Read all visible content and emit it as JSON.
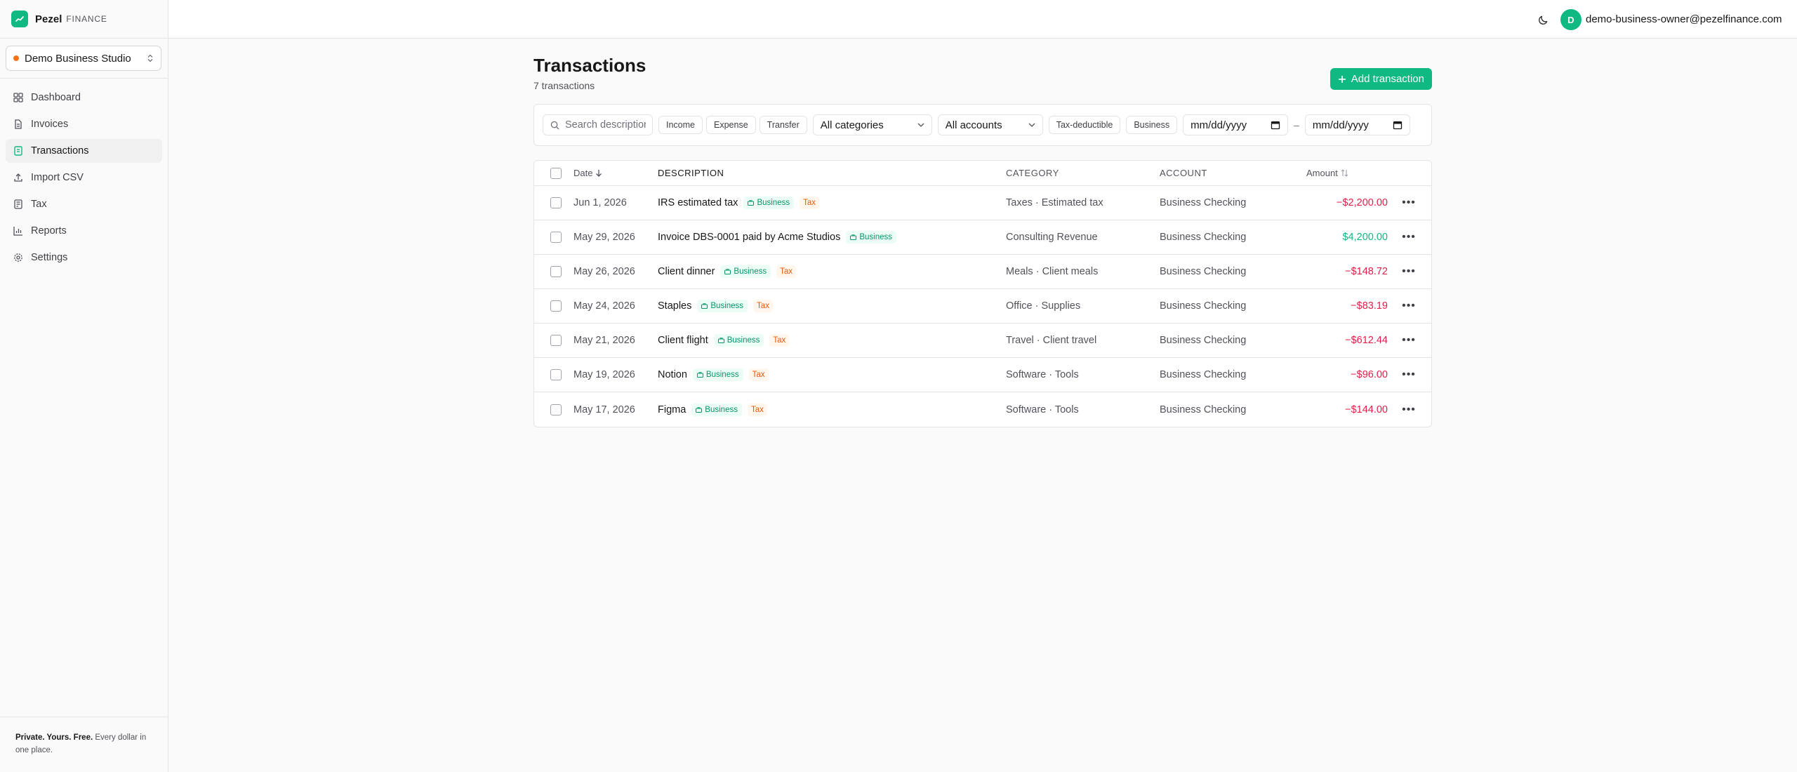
{
  "brand": {
    "name": "Pezel",
    "suffix": "FINANCE"
  },
  "workspace": {
    "name": "Demo Business Studio"
  },
  "nav": [
    {
      "label": "Dashboard",
      "icon": "dashboard-icon",
      "active": false
    },
    {
      "label": "Invoices",
      "icon": "invoice-icon",
      "active": false
    },
    {
      "label": "Transactions",
      "icon": "transactions-icon",
      "active": true
    },
    {
      "label": "Import CSV",
      "icon": "upload-icon",
      "active": false
    },
    {
      "label": "Tax",
      "icon": "tax-icon",
      "active": false
    },
    {
      "label": "Reports",
      "icon": "chart-icon",
      "active": false
    },
    {
      "label": "Settings",
      "icon": "gear-icon",
      "active": false
    }
  ],
  "footer": {
    "bold": "Private. Yours. Free.",
    "text": " Every dollar in one place."
  },
  "user": {
    "initial": "D",
    "email": "demo-business-owner@pezelfinance.com"
  },
  "page": {
    "title": "Transactions",
    "subtitle": "7 transactions",
    "add_label": "Add transaction"
  },
  "filters": {
    "search_placeholder": "Search descriptions",
    "types": [
      "Income",
      "Expense",
      "Transfer"
    ],
    "category": "All categories",
    "account": "All accounts",
    "flags": [
      "Tax-deductible",
      "Business"
    ],
    "date_from": "mm/dd/yyyy",
    "date_sep": "–",
    "date_to": "mm/dd/yyyy"
  },
  "table": {
    "headers": {
      "date": "Date",
      "description": "DESCRIPTION",
      "category": "CATEGORY",
      "account": "ACCOUNT",
      "amount": "Amount"
    },
    "rows": [
      {
        "date": "Jun 1, 2026",
        "description": "IRS estimated tax",
        "business": "Business",
        "tax": "Tax",
        "category": "Taxes · Estimated tax",
        "account": "Business Checking",
        "amount": "−$2,200.00",
        "sign": "neg"
      },
      {
        "date": "May 29, 2026",
        "description": "Invoice DBS-0001 paid by Acme Studios",
        "business": "Business",
        "tax": "",
        "category": "Consulting Revenue",
        "account": "Business Checking",
        "amount": "$4,200.00",
        "sign": "pos"
      },
      {
        "date": "May 26, 2026",
        "description": "Client dinner",
        "business": "Business",
        "tax": "Tax",
        "category": "Meals · Client meals",
        "account": "Business Checking",
        "amount": "−$148.72",
        "sign": "neg"
      },
      {
        "date": "May 24, 2026",
        "description": "Staples",
        "business": "Business",
        "tax": "Tax",
        "category": "Office · Supplies",
        "account": "Business Checking",
        "amount": "−$83.19",
        "sign": "neg"
      },
      {
        "date": "May 21, 2026",
        "description": "Client flight",
        "business": "Business",
        "tax": "Tax",
        "category": "Travel · Client travel",
        "account": "Business Checking",
        "amount": "−$612.44",
        "sign": "neg"
      },
      {
        "date": "May 19, 2026",
        "description": "Notion",
        "business": "Business",
        "tax": "Tax",
        "category": "Software · Tools",
        "account": "Business Checking",
        "amount": "−$96.00",
        "sign": "neg"
      },
      {
        "date": "May 17, 2026",
        "description": "Figma",
        "business": "Business",
        "tax": "Tax",
        "category": "Software · Tools",
        "account": "Business Checking",
        "amount": "−$144.00",
        "sign": "neg"
      }
    ]
  },
  "colors": {
    "accent": "#10b981",
    "negative": "#e11d48",
    "tax": "#ea580c",
    "workspace_dot": "#f97316"
  }
}
